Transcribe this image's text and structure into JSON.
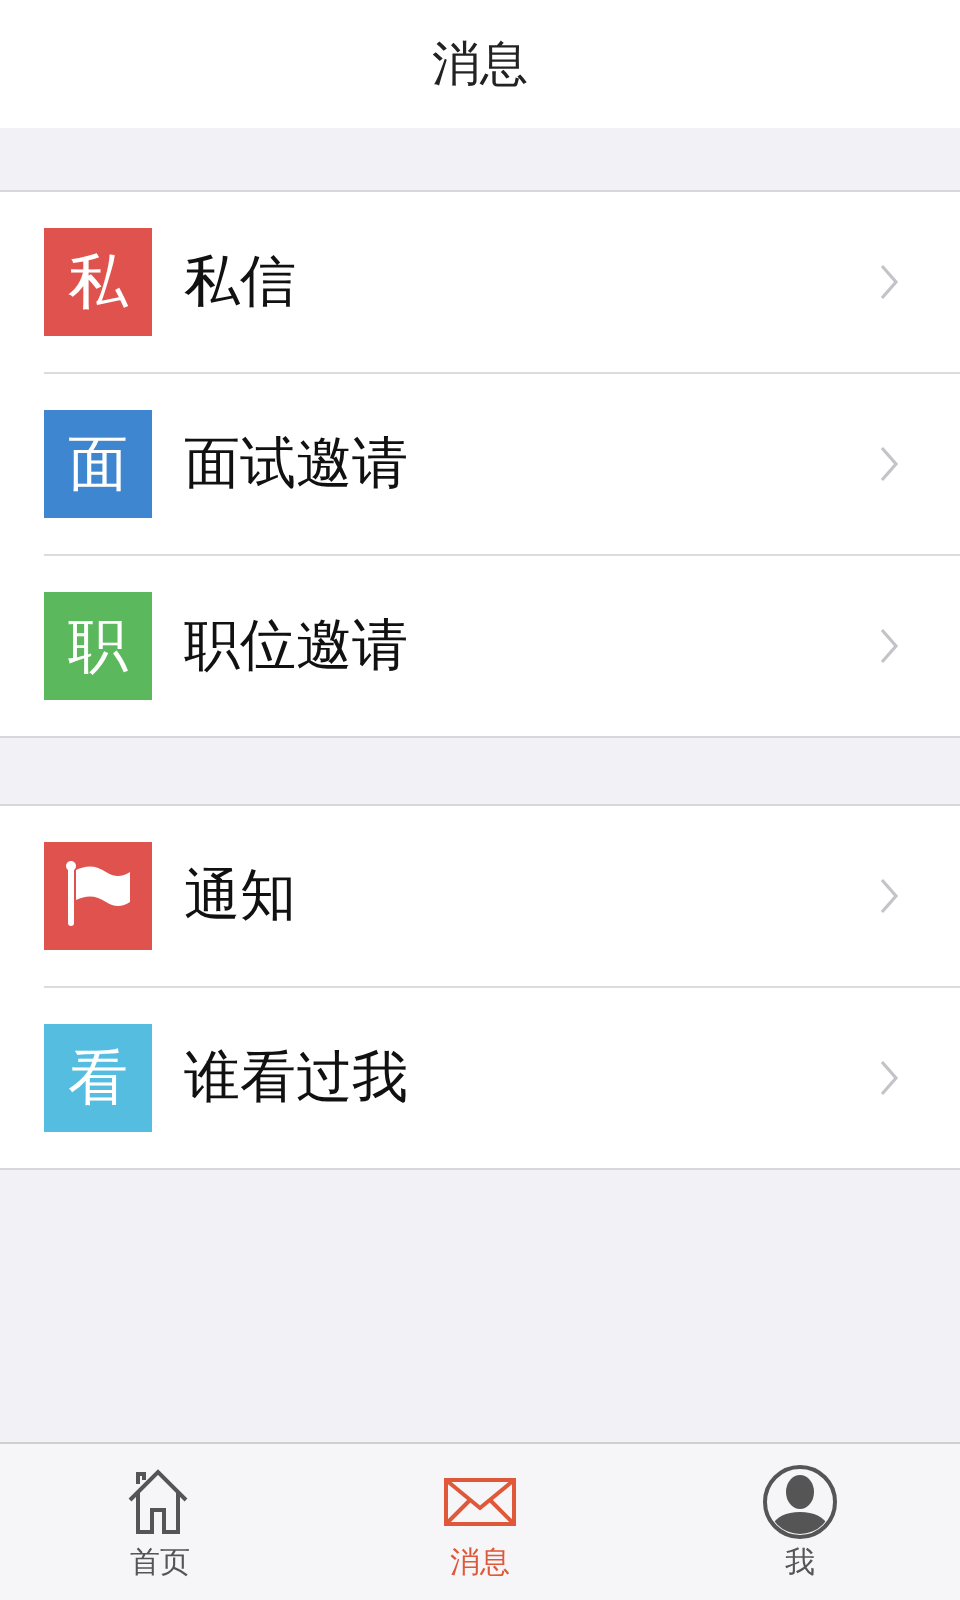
{
  "header": {
    "title": "消息"
  },
  "groups": [
    {
      "items": [
        {
          "kind": "char",
          "glyph": "私",
          "label": "私信",
          "color": "#e0524d"
        },
        {
          "kind": "char",
          "glyph": "面",
          "label": "面试邀请",
          "color": "#3e87d0"
        },
        {
          "kind": "char",
          "glyph": "职",
          "label": "职位邀请",
          "color": "#5cb85c"
        }
      ]
    },
    {
      "items": [
        {
          "kind": "flag",
          "label": "通知",
          "color": "#e0524d"
        },
        {
          "kind": "char",
          "glyph": "看",
          "label": "谁看过我",
          "color": "#55bde0"
        }
      ]
    }
  ],
  "tab_bar": [
    {
      "kind": "home",
      "label": "首页",
      "selected": false
    },
    {
      "kind": "mail",
      "label": "消息",
      "selected": true
    },
    {
      "kind": "person",
      "label": "我",
      "selected": false
    }
  ]
}
